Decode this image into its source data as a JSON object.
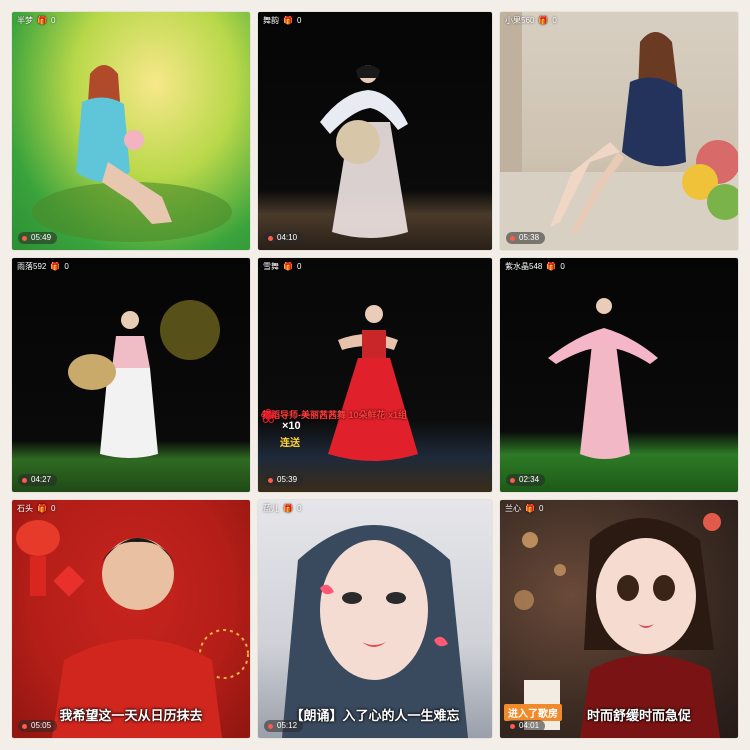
{
  "tiles": [
    {
      "user": "半梦",
      "gift_count": "0",
      "duration": "05:49"
    },
    {
      "user": "舞韵",
      "gift_count": "0",
      "duration": "04:10"
    },
    {
      "user": "小果560",
      "gift_count": "0",
      "duration": "05:38"
    },
    {
      "user": "雨落592",
      "gift_count": "0",
      "duration": "04:27"
    },
    {
      "user": "雪舞",
      "gift_count": "0",
      "duration": "05:39",
      "overlay": {
        "banner": "舞蹈导师-美丽茜茜舞 10朵鲜花 x1组",
        "combo": "×10",
        "combo_label": "连送"
      }
    },
    {
      "user": "紫水晶548",
      "gift_count": "0",
      "duration": "02:34"
    },
    {
      "user": "石头",
      "gift_count": "0",
      "duration": "05:05",
      "caption": "我希望这一天从日历抹去"
    },
    {
      "user": "蓝儿",
      "gift_count": "0",
      "duration": "05:12",
      "caption": "【朗诵】入了心的人一生难忘"
    },
    {
      "user": "兰心",
      "gift_count": "0",
      "duration": "04:01",
      "tag": "进入了歌房",
      "caption": "时而舒缓时而急促"
    }
  ],
  "icons": {
    "gift": "gift-icon",
    "record": "record-dot-icon"
  }
}
